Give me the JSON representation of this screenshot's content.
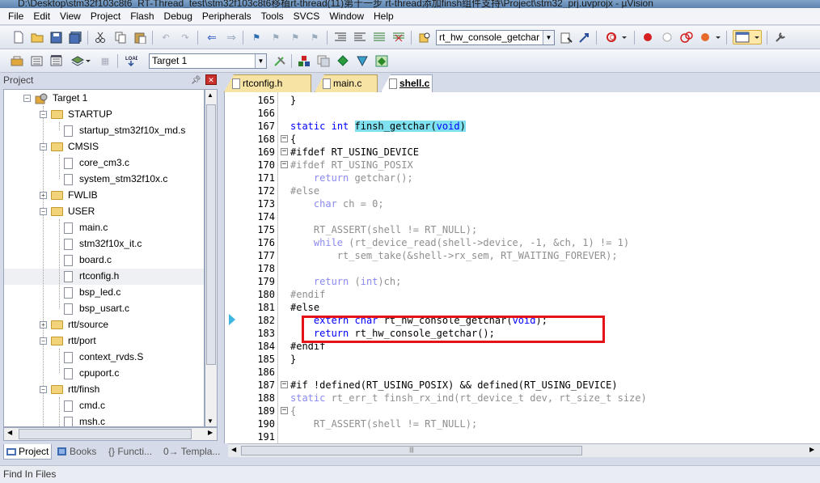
{
  "window": {
    "title": "D:\\Desktop\\stm32f103c8t6_RT-Thread_test\\stm32f103c8t6移植rt-thread(11)第十一步 rt-thread添加finsh组件支持\\Project\\stm32_prj.uvprojx - µVision"
  },
  "menu": [
    "File",
    "Edit",
    "View",
    "Project",
    "Flash",
    "Debug",
    "Peripherals",
    "Tools",
    "SVCS",
    "Window",
    "Help"
  ],
  "toolbar": {
    "find_combo_value": "rt_hw_console_getchar",
    "target_combo_value": "Target 1"
  },
  "project_panel": {
    "title": "Project",
    "tree": [
      {
        "label": "Target 1"
      },
      {
        "label": "STARTUP"
      },
      {
        "label": "startup_stm32f10x_md.s"
      },
      {
        "label": "CMSIS"
      },
      {
        "label": "core_cm3.c"
      },
      {
        "label": "system_stm32f10x.c"
      },
      {
        "label": "FWLIB"
      },
      {
        "label": "USER"
      },
      {
        "label": "main.c"
      },
      {
        "label": "stm32f10x_it.c"
      },
      {
        "label": "board.c"
      },
      {
        "label": "rtconfig.h"
      },
      {
        "label": "bsp_led.c"
      },
      {
        "label": "bsp_usart.c"
      },
      {
        "label": "rtt/source"
      },
      {
        "label": "rtt/port"
      },
      {
        "label": "context_rvds.S"
      },
      {
        "label": "cpuport.c"
      },
      {
        "label": "rtt/finsh"
      },
      {
        "label": "cmd.c"
      },
      {
        "label": "msh.c"
      }
    ],
    "tabs": [
      "Project",
      "Books",
      "{} Functi...",
      "0→ Templa..."
    ]
  },
  "editor": {
    "tabs": [
      {
        "label": "rtconfig.h",
        "active": false
      },
      {
        "label": "main.c",
        "active": false
      },
      {
        "label": "shell.c",
        "active": true
      }
    ],
    "line_numbers": [
      "165",
      "166",
      "167",
      "168",
      "169",
      "170",
      "171",
      "172",
      "173",
      "174",
      "175",
      "176",
      "177",
      "178",
      "179",
      "180",
      "181",
      "182",
      "183",
      "184",
      "185",
      "186",
      "187",
      "188",
      "189",
      "190",
      "191"
    ]
  },
  "bottom": {
    "find_in_files": "Find In Files"
  }
}
